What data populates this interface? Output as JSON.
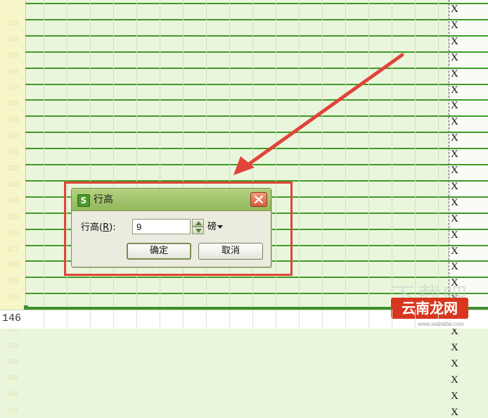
{
  "sheet": {
    "row_numbers": [
      "",
      "313",
      "314",
      "315",
      "316",
      "317",
      "318",
      "319",
      "320",
      "321",
      "322",
      "323",
      "324",
      "325",
      "326",
      "327",
      "328",
      "329",
      "330",
      "331",
      "332",
      "333",
      "334",
      "335",
      "336",
      "337"
    ],
    "bottom_row_number": "146",
    "marker": "X",
    "colors": {
      "background": "#eaf6dc",
      "row_line": "#3f9a26",
      "row_header": "#f6f6c8"
    }
  },
  "dialog": {
    "title": "行高",
    "app_icon_glyph": "S",
    "field_label": "行高",
    "field_label_key": "R",
    "field_label_colon": ":",
    "height_value": "9",
    "unit": "磅",
    "ok_label": "确定",
    "cancel_label": "取消",
    "colors": {
      "titlebar": "#a6c56e",
      "close": "#d95b3c"
    }
  },
  "annotation": {
    "arrow_color": "#e0443a"
  },
  "watermark": {
    "brand": "云南龙网",
    "ghost": "下载吧",
    "url": "www.xiazaiba.com"
  }
}
